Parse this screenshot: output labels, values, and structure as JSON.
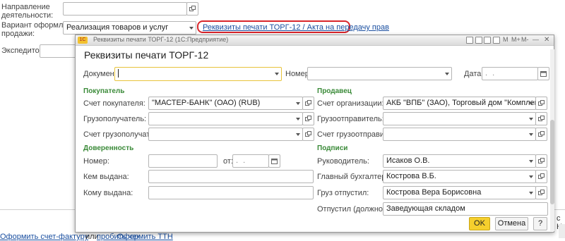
{
  "background_form": {
    "direction_label_line1": "Направление",
    "direction_label_line2": "деятельности:",
    "variant_label_line1": "Вариант оформления",
    "variant_label_line2": "продажи:",
    "variant_value": "Реализация товаров и услуг",
    "print_details_link": "Реквизиты печати ТОРГ-12 / Акта на передачу прав",
    "forwarder_label": "Экспедитор:",
    "bottom_links": {
      "invoice": "Оформить счет-фактуру",
      "or": "или",
      "receipt": "пробить чек",
      "ttn": "Оформить ТТН"
    },
    "right_cut_text": "с Н"
  },
  "dialog": {
    "window_title": "Реквизиты печати ТОРГ-12",
    "window_app": "(1С:Предприятие)",
    "titlebar_letters": [
      "M",
      "M+",
      "M-"
    ],
    "heading": "Реквизиты печати ТОРГ-12",
    "document_label": "Документ:",
    "document_value": "",
    "number_label": "Номер:",
    "number_value": "",
    "date_label": "Дата:",
    "date_placeholder": ". .",
    "buyer": {
      "section": "Покупатель",
      "account_label": "Счет покупателя:",
      "account_value": "\"МАСТЕР-БАНК\" (ОАО) (RUB)",
      "consignee_label": "Грузополучатель:",
      "consignee_value": "",
      "consignee_account_label": "Счет грузополучателя:",
      "consignee_account_value": ""
    },
    "seller": {
      "section": "Продавец",
      "org_account_label": "Счет организации:",
      "org_account_value": "АКБ \"ВПБ\" (ЗАО), Торговый дом \"Комплексный\" (R",
      "shipper_label": "Грузоотправитель:",
      "shipper_value": "",
      "shipper_account_label": "Счет грузоотправителя:",
      "shipper_account_value": ""
    },
    "power_of_attorney": {
      "section": "Доверенность",
      "number_label": "Номер:",
      "from_label": "от:",
      "date_placeholder": ". .",
      "issued_by_label": "Кем выдана:",
      "issued_to_label": "Кому выдана:"
    },
    "signatures": {
      "section": "Подписи",
      "head_label": "Руководитель:",
      "head_value": "Исаков О.В.",
      "accountant_label": "Главный бухгалтер:",
      "accountant_value": "Кострова В.Б.",
      "released_by_label": "Груз отпустил:",
      "released_by_value": "Кострова Вера Борисовна",
      "position_label": "Отпустил (должность):",
      "position_value": "Заведующая складом"
    },
    "ok_label": "OK",
    "cancel_label": "Отмена",
    "help_label": "?"
  },
  "colors": {
    "accent_ok": "#f5cf2d",
    "section_green": "#3a8a38",
    "link_blue": "#1a4fa0",
    "highlight_red": "#d9262b",
    "focus_border": "#e8c33a"
  }
}
